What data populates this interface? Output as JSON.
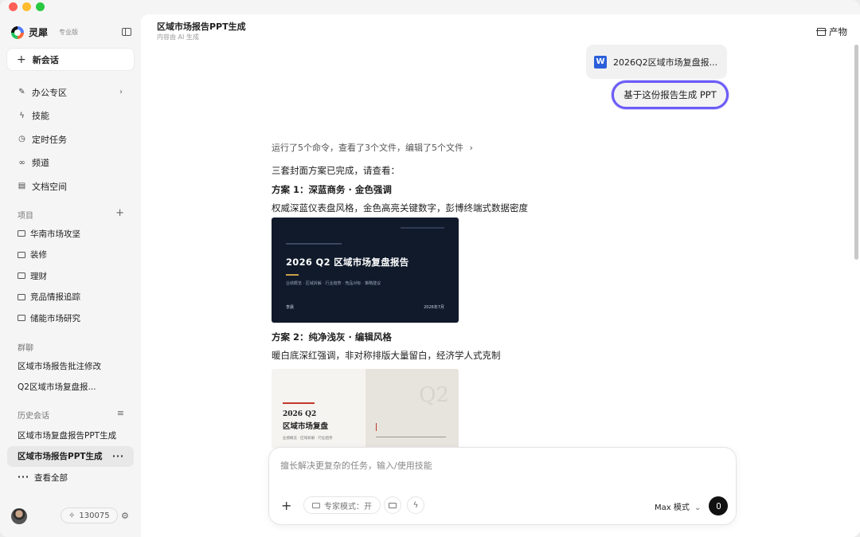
{
  "sidebar": {
    "brand_name": "灵犀",
    "brand_tier": "专业版",
    "new_chat": "新会话",
    "nav": [
      {
        "label": "办公专区",
        "icon": "pencil-icon",
        "glyph": "✎",
        "chevron": "›"
      },
      {
        "label": "技能",
        "icon": "lightning-icon",
        "glyph": "ϟ"
      },
      {
        "label": "定时任务",
        "icon": "clock-icon",
        "glyph": "◷"
      },
      {
        "label": "频道",
        "icon": "link-icon",
        "glyph": "∞"
      },
      {
        "label": "文档空间",
        "icon": "document-icon",
        "glyph": "▤"
      }
    ],
    "projects_heading": "项目",
    "projects_add": "+",
    "projects": [
      "华南市场攻坚",
      "装修",
      "理财",
      "竞品情报追踪",
      "储能市场研究"
    ],
    "groups_heading": "群聊",
    "groups": [
      "区域市场报告批注修改",
      "Q2区域市场复盘报..."
    ],
    "history_heading": "历史会话",
    "history_filter": "≡",
    "history": [
      {
        "label": "区域市场复盘报告PPT生成",
        "active": false
      },
      {
        "label": "区域市场报告PPT生成",
        "active": true,
        "more": "···"
      }
    ],
    "view_all": "查看全部",
    "view_all_glyph": "···",
    "credits": "130075",
    "credits_glyph": "✧",
    "settings_glyph": "⚙"
  },
  "header": {
    "title": "区域市场报告PPT生成",
    "subtitle": "内容由 AI 生成",
    "artifacts_label": "产物"
  },
  "conversation": {
    "file_icon_letter": "W",
    "file_name": "2026Q2区域市场复盘报...",
    "user_prompt": "基于这份报告生成 PPT",
    "activity": "运行了5个命令，查看了3个文件，编辑了5个文件",
    "activity_chevron": "›",
    "intro": "三套封面方案已完成，请查看：",
    "options": [
      {
        "title": "方案 1：深蓝商务 · 金色强调",
        "desc": "权威深蓝仪表盘风格，金色高亮关键数字，彭博终端式数据密度"
      },
      {
        "title": "方案 2：纯净浅灰 · 编辑风格",
        "desc": "暖白底深红强调，非对称排版大量留白，经济学人式克制"
      }
    ],
    "cover1": {
      "title": "2026 Q2 区域市场复盘报告",
      "subtitle": "业绩概览 · 区域拆解 · 行业趋势 · 竞品对标 · 策略建议",
      "author": "李晨",
      "date": "2026年7月"
    },
    "cover2": {
      "big": "Q2",
      "title_line1": "2026 Q2",
      "title_line2": "区域市场复盘",
      "subtitle": "业绩概览 · 区域拆解 · 行业趋势"
    }
  },
  "composer": {
    "placeholder": "擅长解决更复杂的任务，输入/使用技能",
    "plus": "+",
    "expert_mode": "专家模式：开",
    "lightning_glyph": "ϟ",
    "mode": "Max 模式",
    "mode_chevron": "⌄"
  }
}
